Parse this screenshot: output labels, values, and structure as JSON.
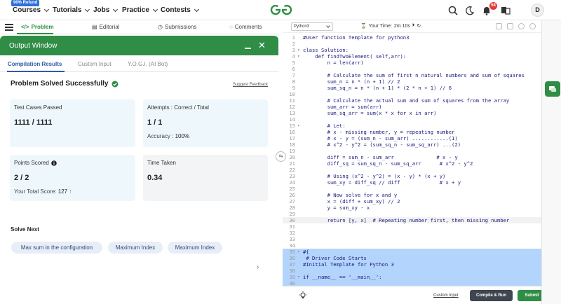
{
  "topnav": {
    "badge": "90% Refund",
    "items": [
      "Courses",
      "Tutorials",
      "Jobs",
      "Practice",
      "Contests"
    ],
    "notification_count": "58",
    "avatar_initial": "D"
  },
  "problem_tabs": [
    "Problem",
    "Editorial",
    "Submissions",
    "Comments"
  ],
  "output": {
    "title": "Output Window",
    "tabs": [
      "Compilation Results",
      "Custom Input",
      "Y.O.G.I. (AI Bot)"
    ],
    "status": "Problem Solved Successfully",
    "feedback": "Suggest Feedback",
    "cards": {
      "tests": {
        "label": "Test Cases Passed",
        "value": "1111 / 1111"
      },
      "attempts": {
        "label": "Attempts : Correct / Total",
        "value": "1 / 1",
        "sub_label": "Accuracy :",
        "sub_value": "100%"
      },
      "points": {
        "label": "Points Scored",
        "value": "2 / 2",
        "sub_label": "Your Total Score:",
        "sub_value": "127"
      },
      "time": {
        "label": "Time Taken",
        "value": "0.34"
      }
    },
    "solve_next_heading": "Solve Next",
    "solve_next": [
      "Max sum in the configuration",
      "Maximum Index",
      "Maximum Index"
    ]
  },
  "editor": {
    "language": "Python3",
    "timer_label": "Your Time:",
    "timer_value": "2m 10s",
    "lines": [
      {
        "n": "1",
        "t": "#User function Template for python3",
        "fold": ""
      },
      {
        "n": "2",
        "t": "",
        "fold": ""
      },
      {
        "n": "3",
        "t": "class Solution:",
        "fold": "▾"
      },
      {
        "n": "4",
        "t": "    def findTwoElement( self,arr):",
        "fold": "▾"
      },
      {
        "n": "5",
        "t": "        n = len(arr)",
        "fold": ""
      },
      {
        "n": "6",
        "t": "",
        "fold": ""
      },
      {
        "n": "7",
        "t": "        # Calculate the sum of first n natural numbers and sum of squares",
        "fold": ""
      },
      {
        "n": "8",
        "t": "        sum_n = n * (n + 1) // 2",
        "fold": ""
      },
      {
        "n": "9",
        "t": "        sum_sq_n = n * (n + 1) * (2 * n + 1) // 6",
        "fold": ""
      },
      {
        "n": "10",
        "t": "",
        "fold": ""
      },
      {
        "n": "11",
        "t": "        # Calculate the actual sum and sum of squares from the array",
        "fold": ""
      },
      {
        "n": "12",
        "t": "        sum_arr = sum(arr)",
        "fold": ""
      },
      {
        "n": "13",
        "t": "        sum_sq_arr = sum(x * x for x in arr)",
        "fold": ""
      },
      {
        "n": "14",
        "t": "",
        "fold": ""
      },
      {
        "n": "15",
        "t": "        # Let:",
        "fold": "▾"
      },
      {
        "n": "16",
        "t": "        # x - missing number, y = repeating number",
        "fold": ""
      },
      {
        "n": "17",
        "t": "        # x - y = (sum_n - sum_arr) ............(1)",
        "fold": ""
      },
      {
        "n": "18",
        "t": "        # x^2 - y^2 = (sum_sq_n - sum_sq_arr) ...(2)",
        "fold": ""
      },
      {
        "n": "19",
        "t": "",
        "fold": ""
      },
      {
        "n": "20",
        "t": "        diff = sum_n - sum_arr              # x - y",
        "fold": ""
      },
      {
        "n": "21",
        "t": "        diff_sq = sum_sq_n - sum_sq_arr      # x^2 - y^2",
        "fold": ""
      },
      {
        "n": "22",
        "t": "",
        "fold": ""
      },
      {
        "n": "23",
        "t": "        # Using (x^2 - y^2) = (x - y) * (x + y)",
        "fold": ""
      },
      {
        "n": "24",
        "t": "        sum_xy = diff_sq // diff             # x + y",
        "fold": ""
      },
      {
        "n": "25",
        "t": "",
        "fold": ""
      },
      {
        "n": "26",
        "t": "        # Now solve for x and y",
        "fold": ""
      },
      {
        "n": "27",
        "t": "        x = (diff + sum_xy) // 2",
        "fold": ""
      },
      {
        "n": "28",
        "t": "        y = sum_xy - x",
        "fold": ""
      },
      {
        "n": "29",
        "t": "",
        "fold": ""
      },
      {
        "n": "30",
        "t": "        return [y, x]  # Repeating number first, then missing number",
        "fold": ""
      },
      {
        "n": "31",
        "t": "",
        "fold": ""
      },
      {
        "n": "32",
        "t": "",
        "fold": ""
      },
      {
        "n": "33",
        "t": "",
        "fold": ""
      },
      {
        "n": "34",
        "t": "",
        "fold": ""
      },
      {
        "n": "35",
        "t": "#{",
        "fold": "▾"
      },
      {
        "n": "36",
        "t": " # Driver Code Starts",
        "fold": ""
      },
      {
        "n": "37",
        "t": "#Initial Template for Python 3",
        "fold": ""
      },
      {
        "n": "38",
        "t": "",
        "fold": ""
      },
      {
        "n": "39",
        "t": "if __name__ == '__main__':",
        "fold": "▾"
      },
      {
        "n": "40",
        "t": "",
        "fold": ""
      }
    ],
    "custom_input": "Custom Input",
    "run_label": "Compile & Run",
    "submit_label": "Submit"
  }
}
